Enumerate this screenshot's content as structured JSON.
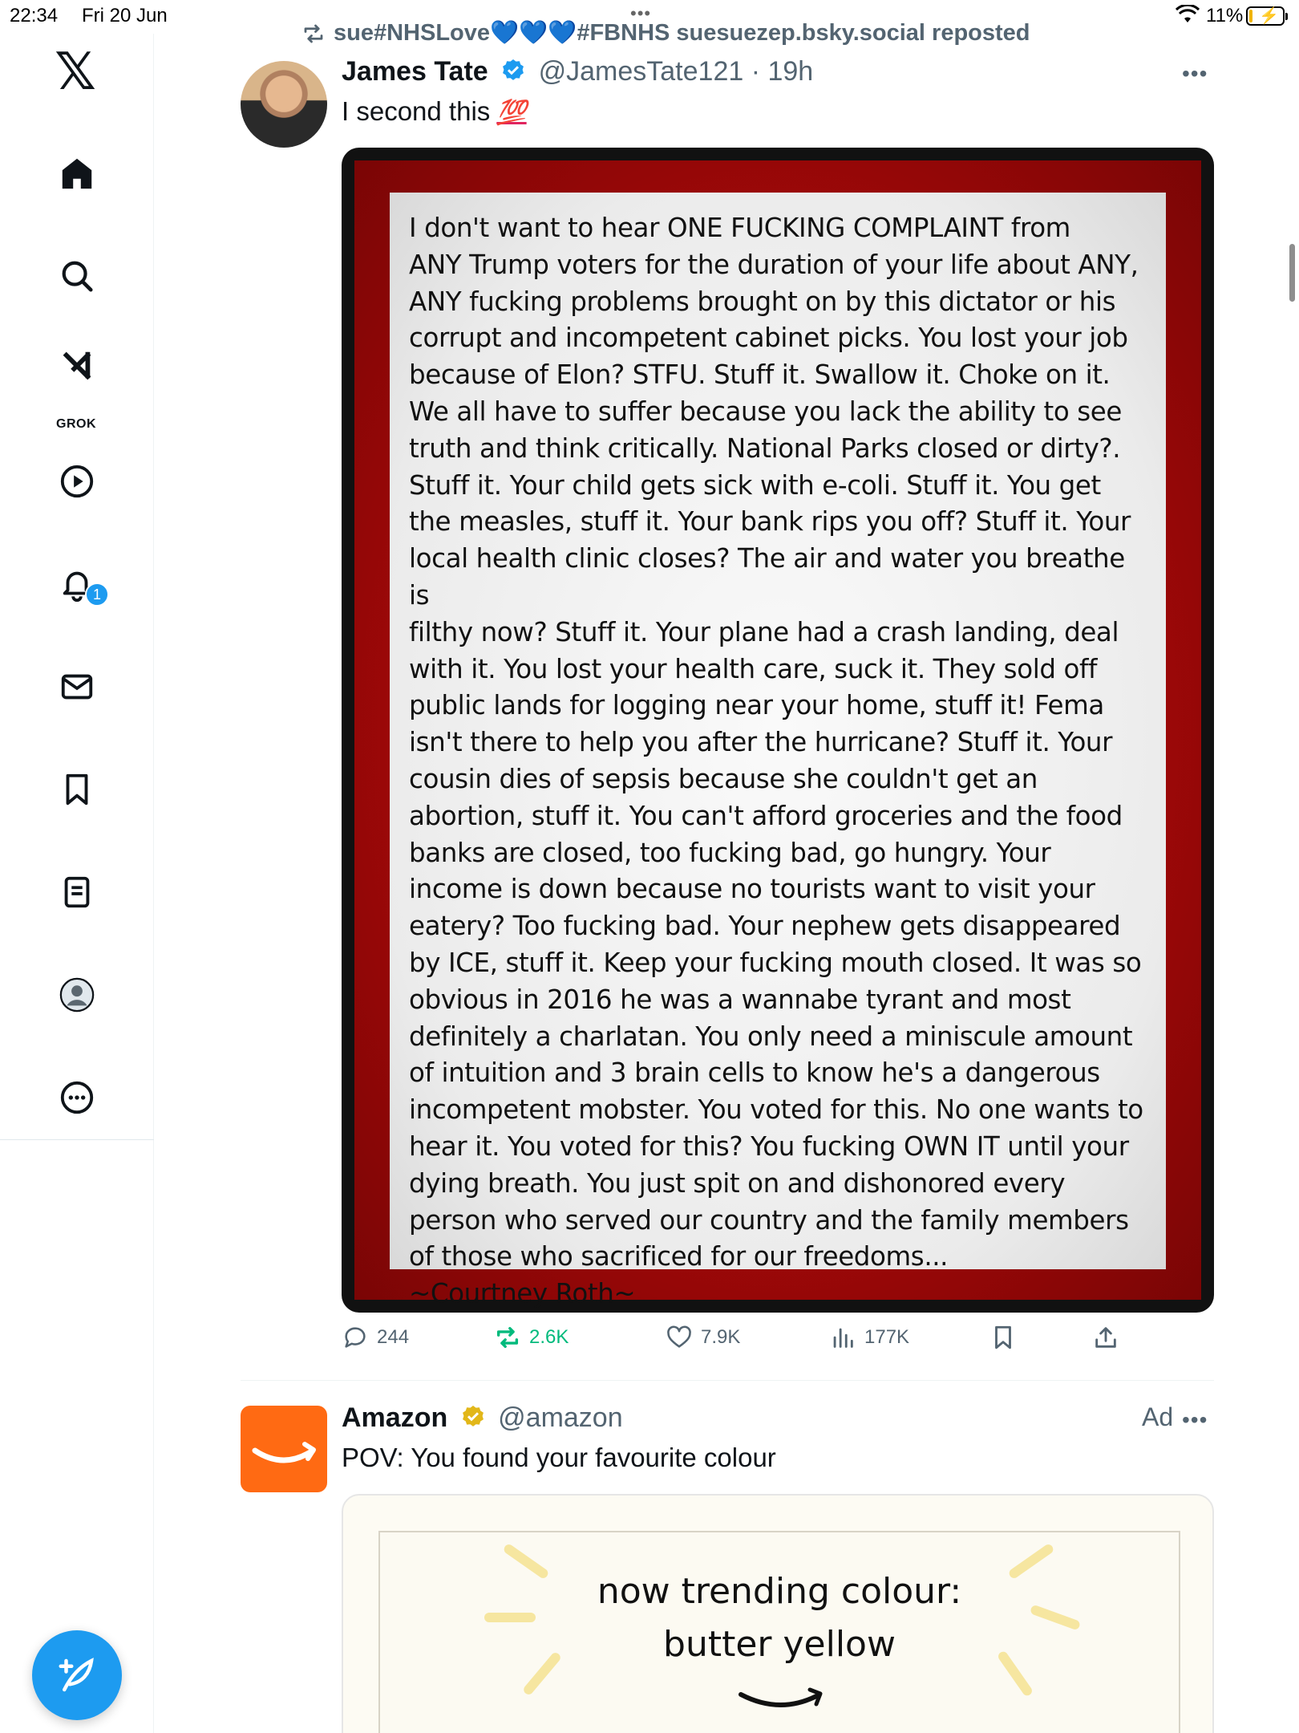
{
  "status_bar": {
    "time": "22:34",
    "date": "Fri 20 Jun",
    "battery_percent": "11%",
    "battery_level": 0.11
  },
  "sidebar": {
    "grok_label": "GROK",
    "notification_count": "1",
    "items": [
      {
        "name": "home",
        "icon": "home-icon"
      },
      {
        "name": "explore",
        "icon": "search-icon"
      },
      {
        "name": "grok",
        "icon": "grok-icon"
      },
      {
        "name": "videos",
        "icon": "play-icon"
      },
      {
        "name": "notifications",
        "icon": "bell-icon"
      },
      {
        "name": "messages",
        "icon": "mail-icon"
      },
      {
        "name": "bookmarks",
        "icon": "bookmark-icon"
      },
      {
        "name": "lists",
        "icon": "list-icon"
      },
      {
        "name": "profile",
        "icon": "profile-icon"
      },
      {
        "name": "more",
        "icon": "more-icon"
      }
    ],
    "compose_icon": "compose-icon"
  },
  "tweet1": {
    "repost_line": "sue#NHSLove💙💙💙#FBNHS suesuezep.bsky.social reposted",
    "author_name": "James Tate",
    "handle": "@JamesTate121",
    "time": "19h",
    "text": "I second this",
    "emoji": "💯",
    "image_text": "I don't want to hear ONE FUCKING COMPLAINT from\nANY Trump voters for the duration of your life about ANY,\nANY fucking problems brought on by this dictator or his\ncorrupt and incompetent cabinet picks. You lost your job\nbecause of Elon? STFU.  Stuff it. Swallow it. Choke on it.\nWe all have to suffer because you lack the ability to see\ntruth and think critically.  National Parks closed or dirty?.\nStuff it. Your child gets sick with e-coli. Stuff it. You get\nthe measles, stuff it. Your bank rips you off? Stuff it. Your\nlocal health clinic closes? The air and water you breathe is\nfilthy now? Stuff it. Your plane had a crash landing, deal\nwith it. You lost your health care, suck it.  They sold off\npublic lands for logging near your home, stuff it! Fema\nisn't there to help you after the hurricane? Stuff it. Your\ncousin dies of sepsis because she couldn't get an\nabortion,  stuff it. You can't afford groceries and the food\nbanks are closed, too fucking bad, go hungry.  Your\nincome is down because no tourists want to visit your\neatery? Too fucking bad. Your nephew gets disappeared\nby ICE, stuff it. Keep your fucking mouth closed.  It was so\nobvious in 2016 he was a wannabe tyrant and most\ndefinitely a charlatan.  You only need a miniscule amount\nof intuition and 3 brain cells to know he's a dangerous\nincompetent mobster. You voted for this. No one wants to\nhear it. You voted for this? You fucking OWN IT until your\ndying breath. You just spit on and dishonored every\nperson who served our country and the family members\nof those who sacrificed for our freedoms...\n~Courtney Roth~",
    "stats": {
      "replies": "244",
      "reposts": "2.6K",
      "likes": "7.9K",
      "views": "177K"
    }
  },
  "tweet2": {
    "author_name": "Amazon",
    "handle": "@amazon",
    "ad_label": "Ad",
    "text": "POV: You found your favourite colour",
    "card_line1": "now trending colour:",
    "card_line2": "butter yellow"
  },
  "colors": {
    "accent": "#1d9bf0",
    "repost_green": "#00ba7c",
    "amazon_orange": "#ff6a13",
    "secondary_text": "#536471"
  }
}
